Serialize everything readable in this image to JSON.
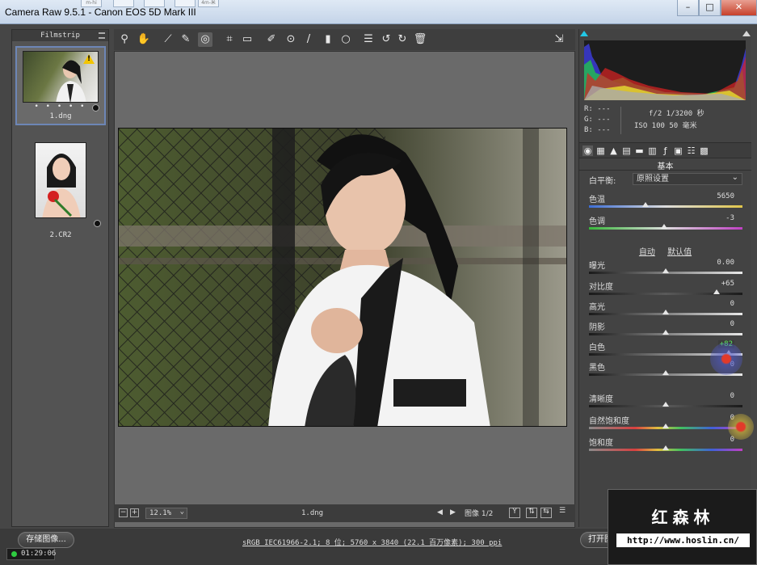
{
  "window": {
    "title": "Camera Raw 9.5.1 -  Canon EOS 5D Mark III",
    "ghost_tabs": [
      "m-hi",
      "",
      "",
      "",
      "4m-米"
    ]
  },
  "filmstrip": {
    "header": "Filmstrip",
    "items": [
      {
        "name": "1.dng",
        "rating_dots": "• • • • •",
        "selected": true,
        "warning": true
      },
      {
        "name": "2.CR2",
        "selected": false,
        "warning": false
      }
    ]
  },
  "toolbar": {
    "icons": [
      "zoom-icon",
      "hand-icon",
      "white-balance-icon",
      "color-sampler-icon",
      "targeted-adjust-icon",
      "crop-icon",
      "straighten-icon",
      "spot-removal-icon",
      "red-eye-icon",
      "adjustment-brush-icon",
      "graduated-filter-icon",
      "radial-filter-icon",
      "preferences-icon",
      "rotate-left-icon",
      "rotate-right-icon",
      "trash-icon",
      "fullscreen-icon"
    ]
  },
  "preview_status": {
    "zoom": "12.1%",
    "filename": "1.dng",
    "image_counter": "图像 1/2"
  },
  "readout": {
    "r": "R:  ---",
    "g": "G:  ---",
    "b": "B:  ---",
    "exposure": "f/2   1/3200 秒",
    "iso_focal": "ISO 100   50 毫米"
  },
  "panel": {
    "title": "基本",
    "white_balance_label": "白平衡:",
    "white_balance_value": "原照设置",
    "auto_label": "自动",
    "default_label": "默认值",
    "sliders": [
      {
        "label": "色温",
        "value": "5650",
        "pos": 0.37
      },
      {
        "label": "色调",
        "value": "-3",
        "pos": 0.49
      },
      {
        "label": "曝光",
        "value": "0.00",
        "pos": 0.5
      },
      {
        "label": "对比度",
        "value": "+65",
        "pos": 0.83
      },
      {
        "label": "高光",
        "value": "0",
        "pos": 0.5
      },
      {
        "label": "阴影",
        "value": "0",
        "pos": 0.5
      },
      {
        "label": "白色",
        "value": "+82",
        "pos": 0.91
      },
      {
        "label": "黑色",
        "value": "0",
        "pos": 0.5
      },
      {
        "label": "清晰度",
        "value": "0",
        "pos": 0.5
      },
      {
        "label": "自然饱和度",
        "value": "0",
        "pos": 0.5
      },
      {
        "label": "饱和度",
        "value": "0",
        "pos": 0.5
      }
    ]
  },
  "bottom": {
    "save_button": "存储图像...",
    "workflow_link": "sRGB IEC61966-2.1; 8 位; 5760 x 3840 (22.1 百万像素); 300 ppi",
    "open_button": "打开图像",
    "recording_time": "01:29:06"
  },
  "watermark": {
    "name": "红森林",
    "url": "http://www.hoslin.cn/"
  },
  "colors": {
    "accent": "#6d86b6",
    "highlight_value": "#5cf05c"
  }
}
